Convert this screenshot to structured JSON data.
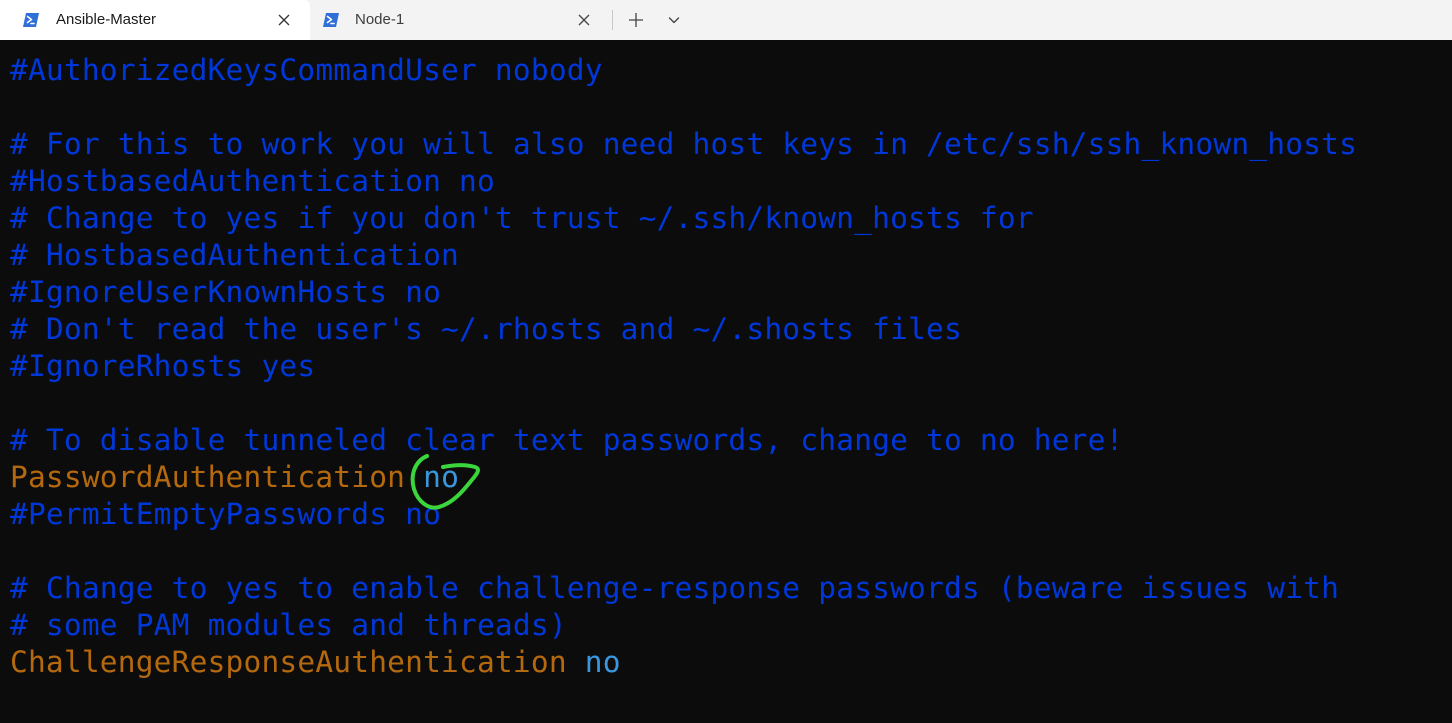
{
  "tabs": [
    {
      "label": "Ansible-Master",
      "icon": "powershell-icon",
      "active": true
    },
    {
      "label": "Node-1",
      "icon": "powershell-icon",
      "active": false
    }
  ],
  "tabbar": {
    "new_tab_icon": "plus-icon",
    "dropdown_icon": "chevron-down-icon"
  },
  "terminal": {
    "lines": [
      {
        "text": "#AuthorizedKeysCommandUser nobody"
      },
      {
        "text": ""
      },
      {
        "text": "# For this to work you will also need host keys in /etc/ssh/ssh_known_hosts"
      },
      {
        "text": "#HostbasedAuthentication no"
      },
      {
        "text": "# Change to yes if you don't trust ~/.ssh/known_hosts for"
      },
      {
        "text": "# HostbasedAuthentication"
      },
      {
        "text": "#IgnoreUserKnownHosts no"
      },
      {
        "text": "# Don't read the user's ~/.rhosts and ~/.shosts files"
      },
      {
        "text": "#IgnoreRhosts yes"
      },
      {
        "text": ""
      },
      {
        "text": "# To disable tunneled clear text passwords, change to no here!"
      },
      {
        "key": "PasswordAuthentication",
        "value": "no"
      },
      {
        "text": "#PermitEmptyPasswords no"
      },
      {
        "text": ""
      },
      {
        "text": "# Change to yes to enable challenge-response passwords (beware issues with"
      },
      {
        "text": "# some PAM modules and threads)"
      },
      {
        "key": "ChallengeResponseAuthentication",
        "value": "no"
      }
    ]
  },
  "colors": {
    "comment": "#0037da",
    "key": "#b4690e",
    "value": "#3a96dd",
    "annotation": "#3bd63b",
    "background": "#0c0c0c"
  }
}
